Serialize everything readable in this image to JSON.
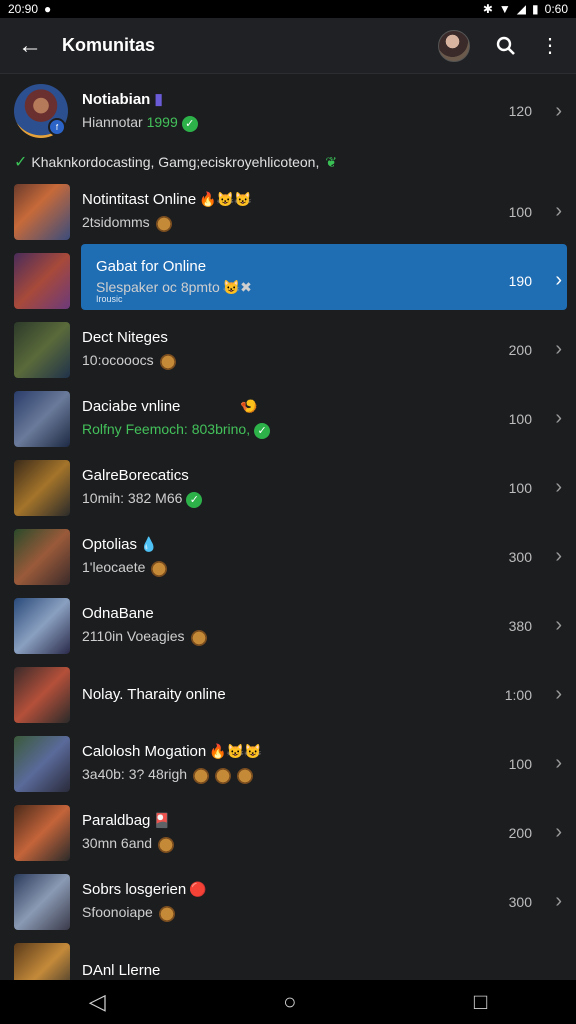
{
  "status": {
    "time": "20:90",
    "right_time": "0:60"
  },
  "header": {
    "title": "Komunitas"
  },
  "profile": {
    "name": "Notiabian",
    "sub_prefix": "Hiannotar",
    "sub_num": "1999",
    "count": "120"
  },
  "banner": {
    "text": "Khaknkordocasting, Gamg;eciskroyehlicoteon,"
  },
  "rows": [
    {
      "name": "Notintitast Online",
      "sub": "2tsidomms",
      "count": "100",
      "emoji": "🔥😺😺",
      "sub_icon": "coin"
    },
    {
      "name": "Gabat for Online",
      "sub": "Slespaker oc 8pmto",
      "sub_small": "Irousic",
      "count": "190",
      "emoji": "",
      "sub_icon": "😺✖",
      "selected": true
    },
    {
      "name": "Dect Niteges",
      "sub": "10:ocooocs",
      "count": "200",
      "emoji": "",
      "sub_icon": "coin"
    },
    {
      "name": "Daciabe vnline",
      "sub": "Rolfny Feemoch: 803brino,",
      "count": "100",
      "emoji": "🍤",
      "sub_icon": "check"
    },
    {
      "name": "GalreBorecatics",
      "sub": "10mih: 382 M66",
      "count": "100",
      "emoji": "",
      "sub_icon": "check"
    },
    {
      "name": "Optolias",
      "sub": "1'leocaete",
      "count": "300",
      "emoji": "💧",
      "sub_icon": "coin"
    },
    {
      "name": "OdnaBane",
      "sub": "2110in Voeagies",
      "count": "380",
      "emoji": "",
      "sub_icon": "coin"
    },
    {
      "name": "Nolay. Tharaity online",
      "sub": "",
      "count": "1:00",
      "emoji": "",
      "sub_icon": ""
    },
    {
      "name": "Calolosh Mogation",
      "sub": "3a40b: 3? 48righ",
      "count": "100",
      "emoji": "🔥😺😺",
      "sub_icon": "coins3"
    },
    {
      "name": "Paraldbag",
      "sub": "30mn 6and",
      "count": "200",
      "emoji": "🎴",
      "sub_icon": "coin"
    },
    {
      "name": "Sobrs losgerien",
      "sub": "Sfoonoiape",
      "count": "300",
      "emoji": "🔴",
      "sub_icon": "coin"
    },
    {
      "name": "DAnl Llerne",
      "sub": "",
      "count": "",
      "emoji": "",
      "sub_icon": ""
    }
  ],
  "colors": {
    "selected": "#1f6db3",
    "check": "#2db24a"
  }
}
